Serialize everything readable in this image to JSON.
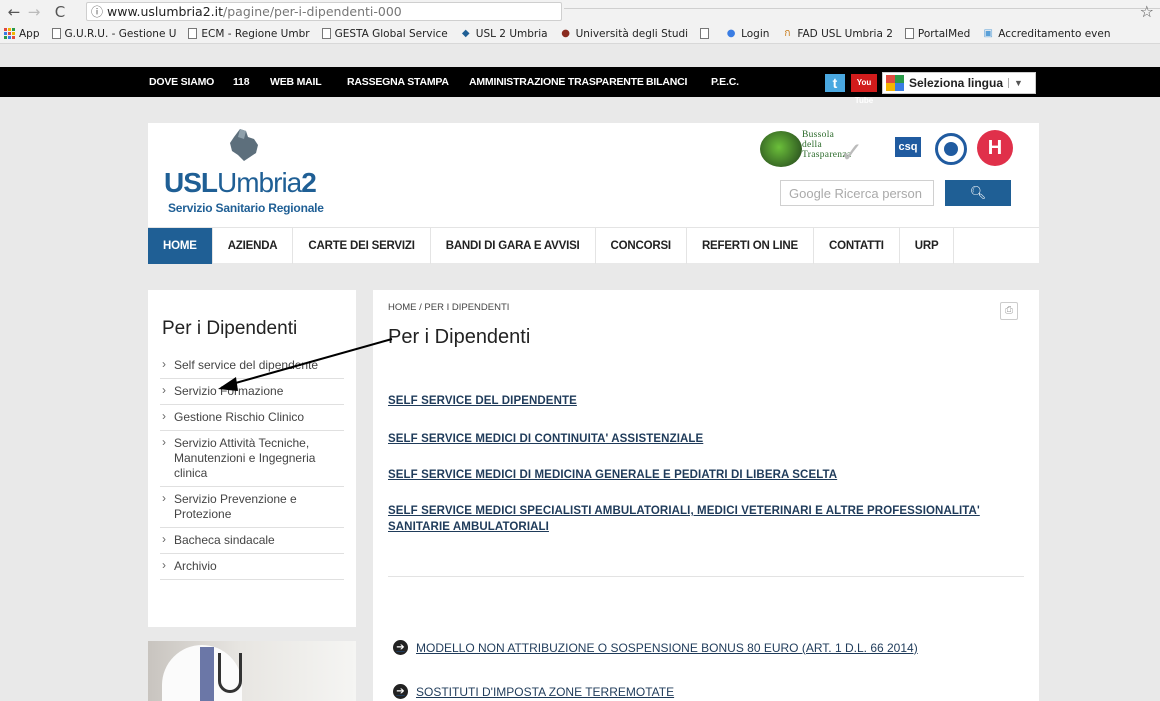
{
  "browser": {
    "url_host": "www.uslumbria2.it",
    "url_path": "/pagine/per-i-dipendenti-000",
    "bookmarks": [
      {
        "label": "App",
        "icon": "apps-grid-icon"
      },
      {
        "label": "G.U.R.U. - Gestione U",
        "icon": "page-icon"
      },
      {
        "label": "ECM - Regione Umbr",
        "icon": "page-icon"
      },
      {
        "label": "GESTA Global Service",
        "icon": "page-icon"
      },
      {
        "label": "USL 2 Umbria",
        "icon": "usl-favicon-icon"
      },
      {
        "label": "Università degli Studi",
        "icon": "university-favicon-icon"
      },
      {
        "label": "",
        "icon": "page-icon"
      },
      {
        "label": "Login",
        "icon": "login-favicon-icon"
      },
      {
        "label": "FAD USL Umbria 2",
        "icon": "fad-favicon-icon"
      },
      {
        "label": "PortalMed",
        "icon": "page-icon"
      },
      {
        "label": "Accreditamento even",
        "icon": "accreditamento-favicon-icon"
      }
    ]
  },
  "topbar": {
    "links": [
      "DOVE SIAMO",
      "118",
      "WEB MAIL",
      "RASSEGNA STAMPA",
      "AMMINISTRAZIONE TRASPARENTE",
      "BILANCI",
      "P.E.C."
    ],
    "youtube_label": "You Tube",
    "language_label": "Seleziona lingua"
  },
  "header": {
    "logo_usl": "USL",
    "logo_umbria": "Umbria",
    "logo_two": "2",
    "logo_sub": "Servizio Sanitario Regionale",
    "bussola_lines": [
      "Bussola",
      "della",
      "Trasparenza"
    ],
    "csq_label": "csq",
    "hosp_label": "H",
    "search_placeholder": "Google Ricerca person"
  },
  "nav": [
    "HOME",
    "AZIENDA",
    "CARTE DEI SERVIZI",
    "BANDI DI GARA E AVVISI",
    "CONCORSI",
    "REFERTI ON LINE",
    "CONTATTI",
    "URP"
  ],
  "sidebar": {
    "title": "Per i Dipendenti",
    "items": [
      "Self service del dipendente",
      "Servizio Formazione",
      "Gestione Rischio Clinico",
      "Servizio Attività Tecniche, Manutenzioni e Ingegneria clinica",
      "Servizio Prevenzione e Protezione",
      "Bacheca sindacale",
      "Archivio"
    ]
  },
  "content": {
    "breadcrumb": "HOME / PER I DIPENDENTI",
    "title": "Per i Dipendenti",
    "links": [
      "SELF SERVICE DEL DIPENDENTE",
      "SELF SERVICE MEDICI DI CONTINUITA' ASSISTENZIALE",
      "SELF SERVICE MEDICI DI MEDICINA GENERALE E PEDIATRI DI LIBERA SCELTA",
      "SELF SERVICE MEDICI SPECIALISTI AMBULATORIALI, MEDICI VETERINARI E ALTRE PROFESSIONALITA' SANITARIE AMBULATORIALI"
    ],
    "docs": [
      "MODELLO NON ATTRIBUZIONE O SOSPENSIONE BONUS 80 EURO (ART. 1 D.L. 66 2014)",
      "SOSTITUTI D'IMPOSTA ZONE TERREMOTATE"
    ]
  },
  "colors": {
    "brand_blue": "#1f5f95",
    "link_navy": "#1f3b5a",
    "topbar_bg": "#000000",
    "page_bg": "#e9e9e9"
  }
}
